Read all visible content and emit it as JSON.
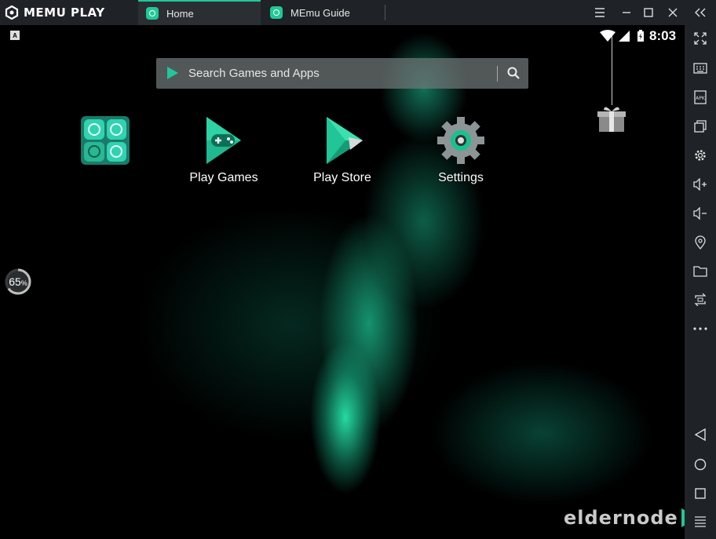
{
  "app": {
    "name": "MEMU PLAY",
    "accent_color": "#1fc79b"
  },
  "tabs": [
    {
      "label": "Home",
      "active": true
    },
    {
      "label": "MEmu Guide",
      "active": false
    }
  ],
  "window_controls": [
    "menu-icon",
    "minimize-icon",
    "maximize-icon",
    "close-icon"
  ],
  "status_bar": {
    "keyboard_indicator": "A",
    "time": "8:03"
  },
  "search": {
    "placeholder": "Search Games and Apps"
  },
  "home_apps": [
    {
      "label": "Play Games",
      "icon": "play-games-icon"
    },
    {
      "label": "Play Store",
      "icon": "play-store-icon"
    },
    {
      "label": "Settings",
      "icon": "settings-icon"
    }
  ],
  "progress": {
    "value_label": "65",
    "unit": "%",
    "fraction": 0.65
  },
  "sidebar_icons": [
    "fullscreen-icon",
    "keyboard-icon",
    "apk-icon",
    "multi-window-icon",
    "gear-icon",
    "volume-up-icon",
    "volume-down-icon",
    "location-icon",
    "folder-icon",
    "rotate-icon",
    "more-icon",
    "back-icon",
    "home-circle-icon",
    "recents-square-icon",
    "menu-lines-icon"
  ],
  "sidebar_apk_label": "APK",
  "watermark": {
    "text": "eldernode"
  }
}
